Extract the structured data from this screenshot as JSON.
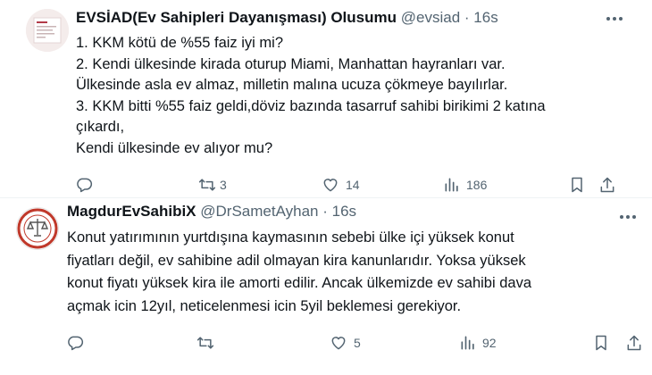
{
  "tweets": [
    {
      "name": "EVSİAD(Ev Sahipleri Dayanışması) Olusumu",
      "handle": "@evsiad",
      "separator": "·",
      "time": "16s",
      "lines": [
        "1. KKM kötü de %55 faiz iyi mi?",
        "2. Kendi ülkesinde kirada oturup Miami, Manhattan hayranları var.",
        "Ülkesinde asla ev almaz, milletin malına ucuza çökmeye bayılırlar.",
        "3. KKM bitti %55 faiz geldi,döviz bazında tasarruf sahibi birikimi 2 katına",
        "çıkardı,",
        "Kendi ülkesinde ev alıyor mu?"
      ],
      "actions": {
        "replies": "",
        "retweets": "3",
        "likes": "14",
        "views": "186"
      }
    },
    {
      "name": "MagdurEvSahibiX",
      "handle": "@DrSametAyhan",
      "separator": "·",
      "time": "16s",
      "lines": [
        "Konut yatırımının yurtdışına kaymasının sebebi ülke içi yüksek konut",
        "fiyatları değil, ev sahibine adil olmayan kira kanunlarıdır. Yoksa yüksek",
        "konut fiyatı yüksek kira ile amorti edilir. Ancak ülkemizde ev sahibi dava",
        "açmak icin 12yıl, neticelenmesi icin 5yil beklemesi gerekiyor."
      ],
      "actions": {
        "replies": "",
        "retweets": "",
        "likes": "5",
        "views": "92"
      }
    }
  ],
  "colors": {
    "text": "#0f1419",
    "muted": "#536471",
    "divider": "#eff3f4"
  },
  "icons": [
    "reply-icon",
    "retweet-icon",
    "like-icon",
    "views-icon",
    "bookmark-icon",
    "share-icon",
    "more-icon"
  ]
}
